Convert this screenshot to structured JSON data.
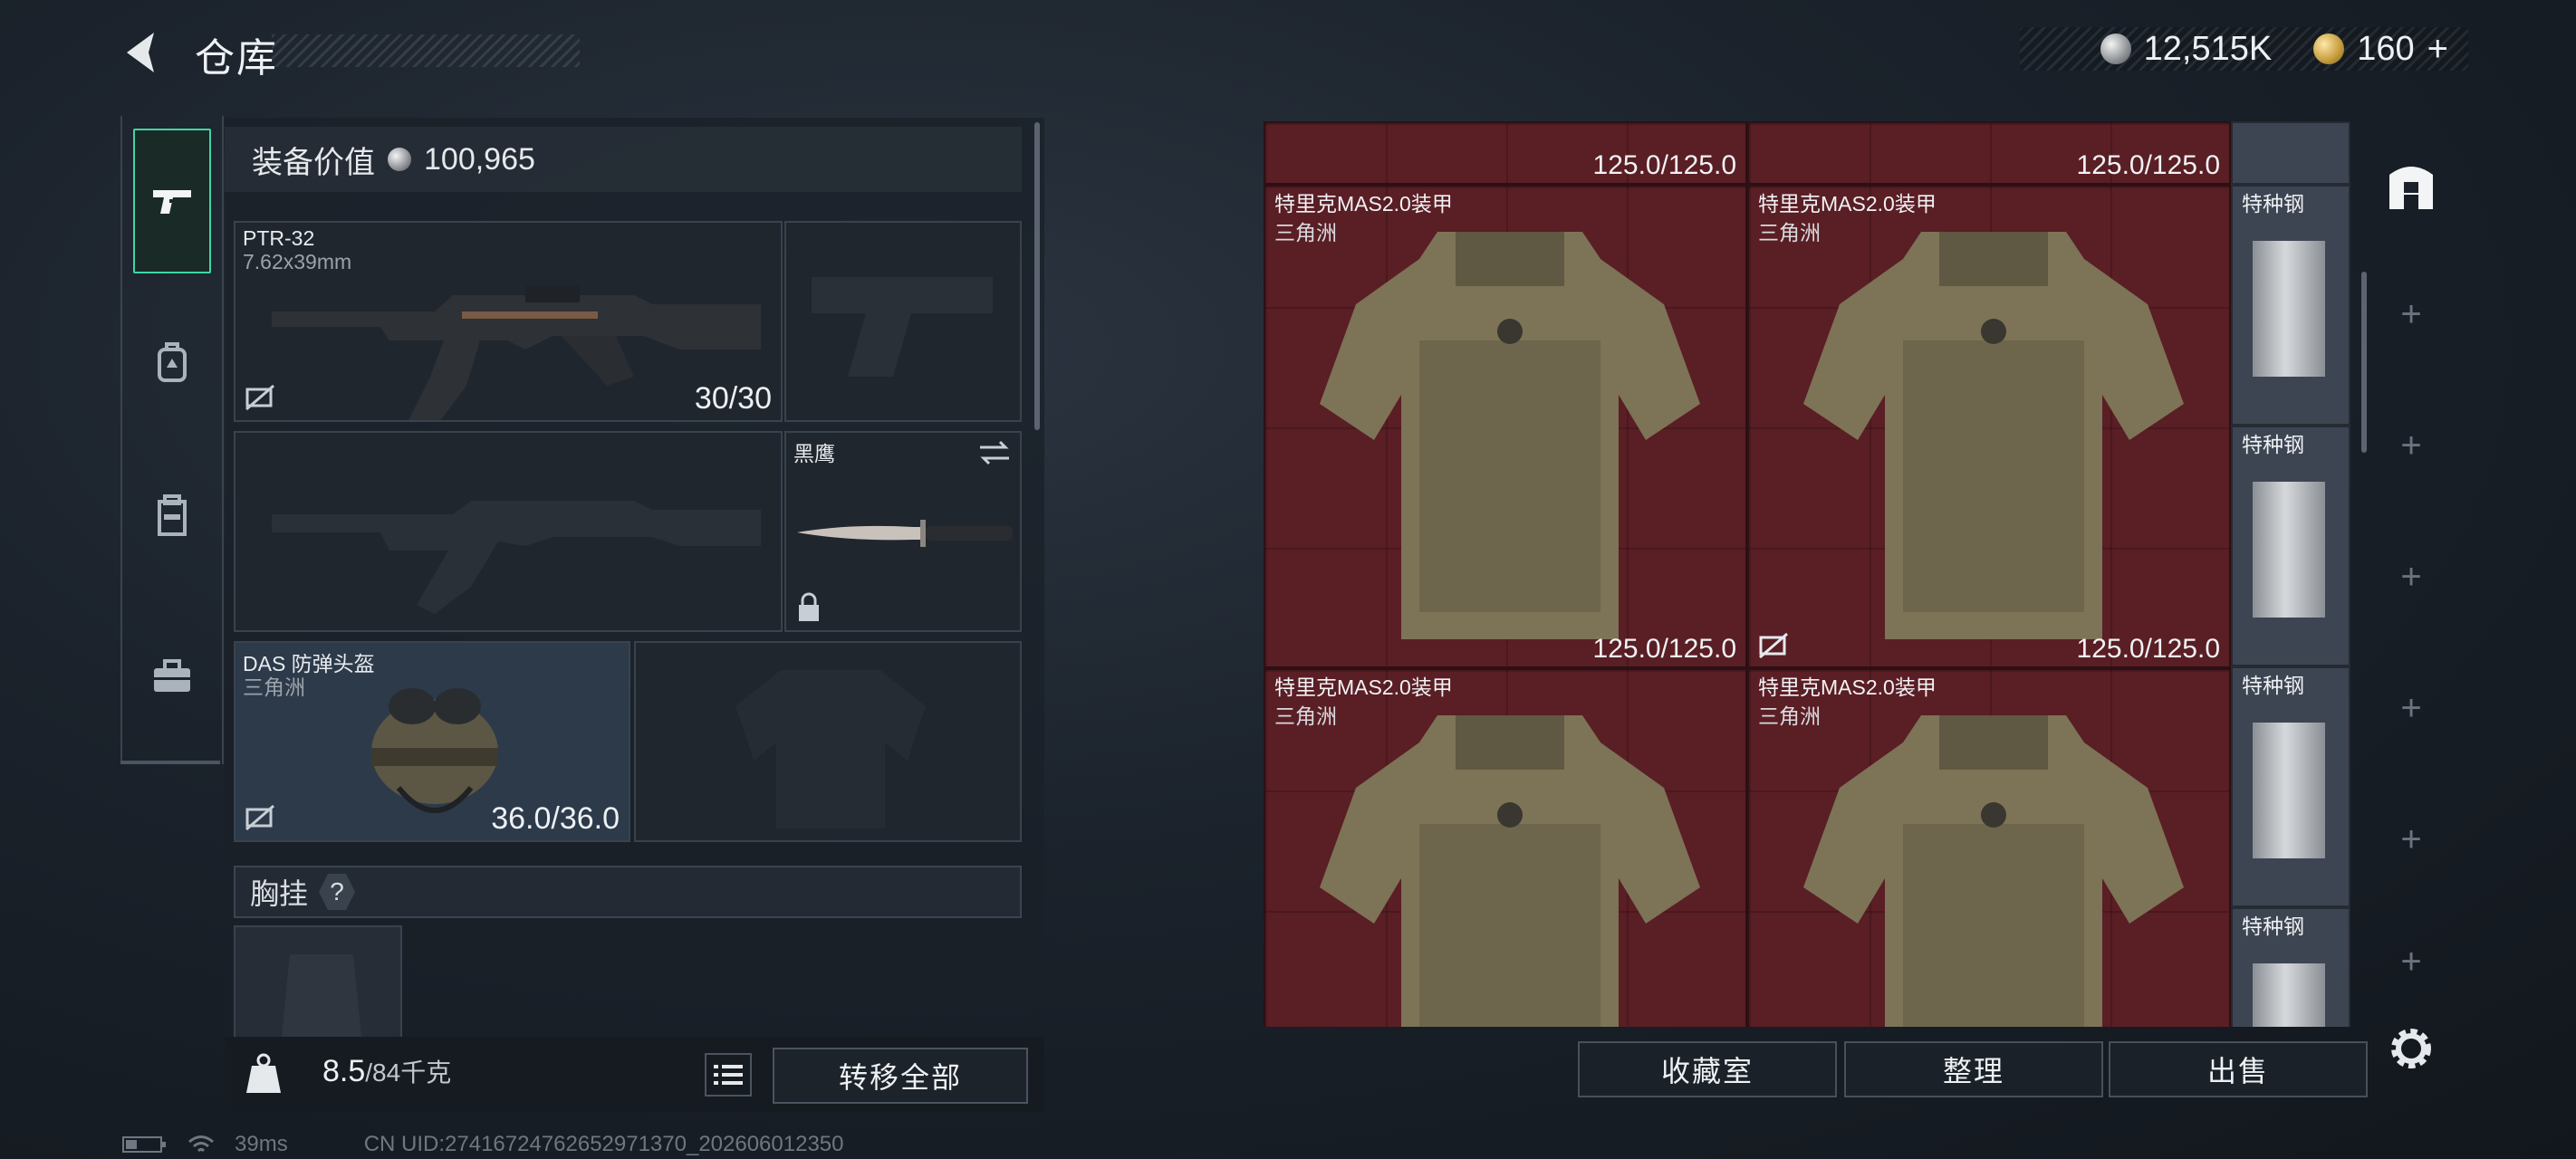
{
  "header": {
    "title": "仓库",
    "currency_silver": "12,515K",
    "currency_gold": "160",
    "gold_plus": "+"
  },
  "equipment": {
    "value_label": "装备价值",
    "value": "100,965",
    "primary_weapon": {
      "name": "PTR-32",
      "ammo": "7.62x39mm",
      "durability": "30/30"
    },
    "melee": {
      "name": "黑鹰"
    },
    "helmet": {
      "name": "DAS 防弹头盔",
      "sub": "三角洲",
      "durability": "36.0/36.0"
    },
    "chest_rig_label": "胸挂",
    "chest_rig_help": "?",
    "weight_value": "8.5",
    "weight_max": "/84千克",
    "transfer_all": "转移全部"
  },
  "storage": {
    "top_durabilities": [
      "125.0/125.0",
      "125.0/125.0"
    ],
    "armors": [
      {
        "name": "特里克MAS2.0装甲",
        "sub": "三角洲",
        "durability": "125.0/125.0"
      },
      {
        "name": "特里克MAS2.0装甲",
        "sub": "三角洲",
        "durability": "125.0/125.0"
      },
      {
        "name": "特里克MAS2.0装甲",
        "sub": "三角洲"
      },
      {
        "name": "特里克MAS2.0装甲",
        "sub": "三角洲"
      }
    ],
    "steel": [
      "特种钢",
      "特种钢",
      "特种钢",
      "特种钢"
    ]
  },
  "actions": {
    "collection": "收藏室",
    "organize": "整理",
    "sell": "出售"
  },
  "status": {
    "ping": "39ms",
    "uid": "CN UID:27416724762652971370_202606012350"
  },
  "tabs": {
    "plus": "+"
  },
  "colors": {
    "accent": "#3fd6a6",
    "armor_bg": "#5a1e25"
  },
  "icons": [
    "back-arrow-icon",
    "pistol-icon",
    "backpack-icon",
    "vest-icon",
    "toolbox-icon",
    "storage-home-icon",
    "settings-icon",
    "kg-weight-icon",
    "list-icon",
    "swap-icon",
    "lock-icon",
    "no-insure-icon"
  ]
}
